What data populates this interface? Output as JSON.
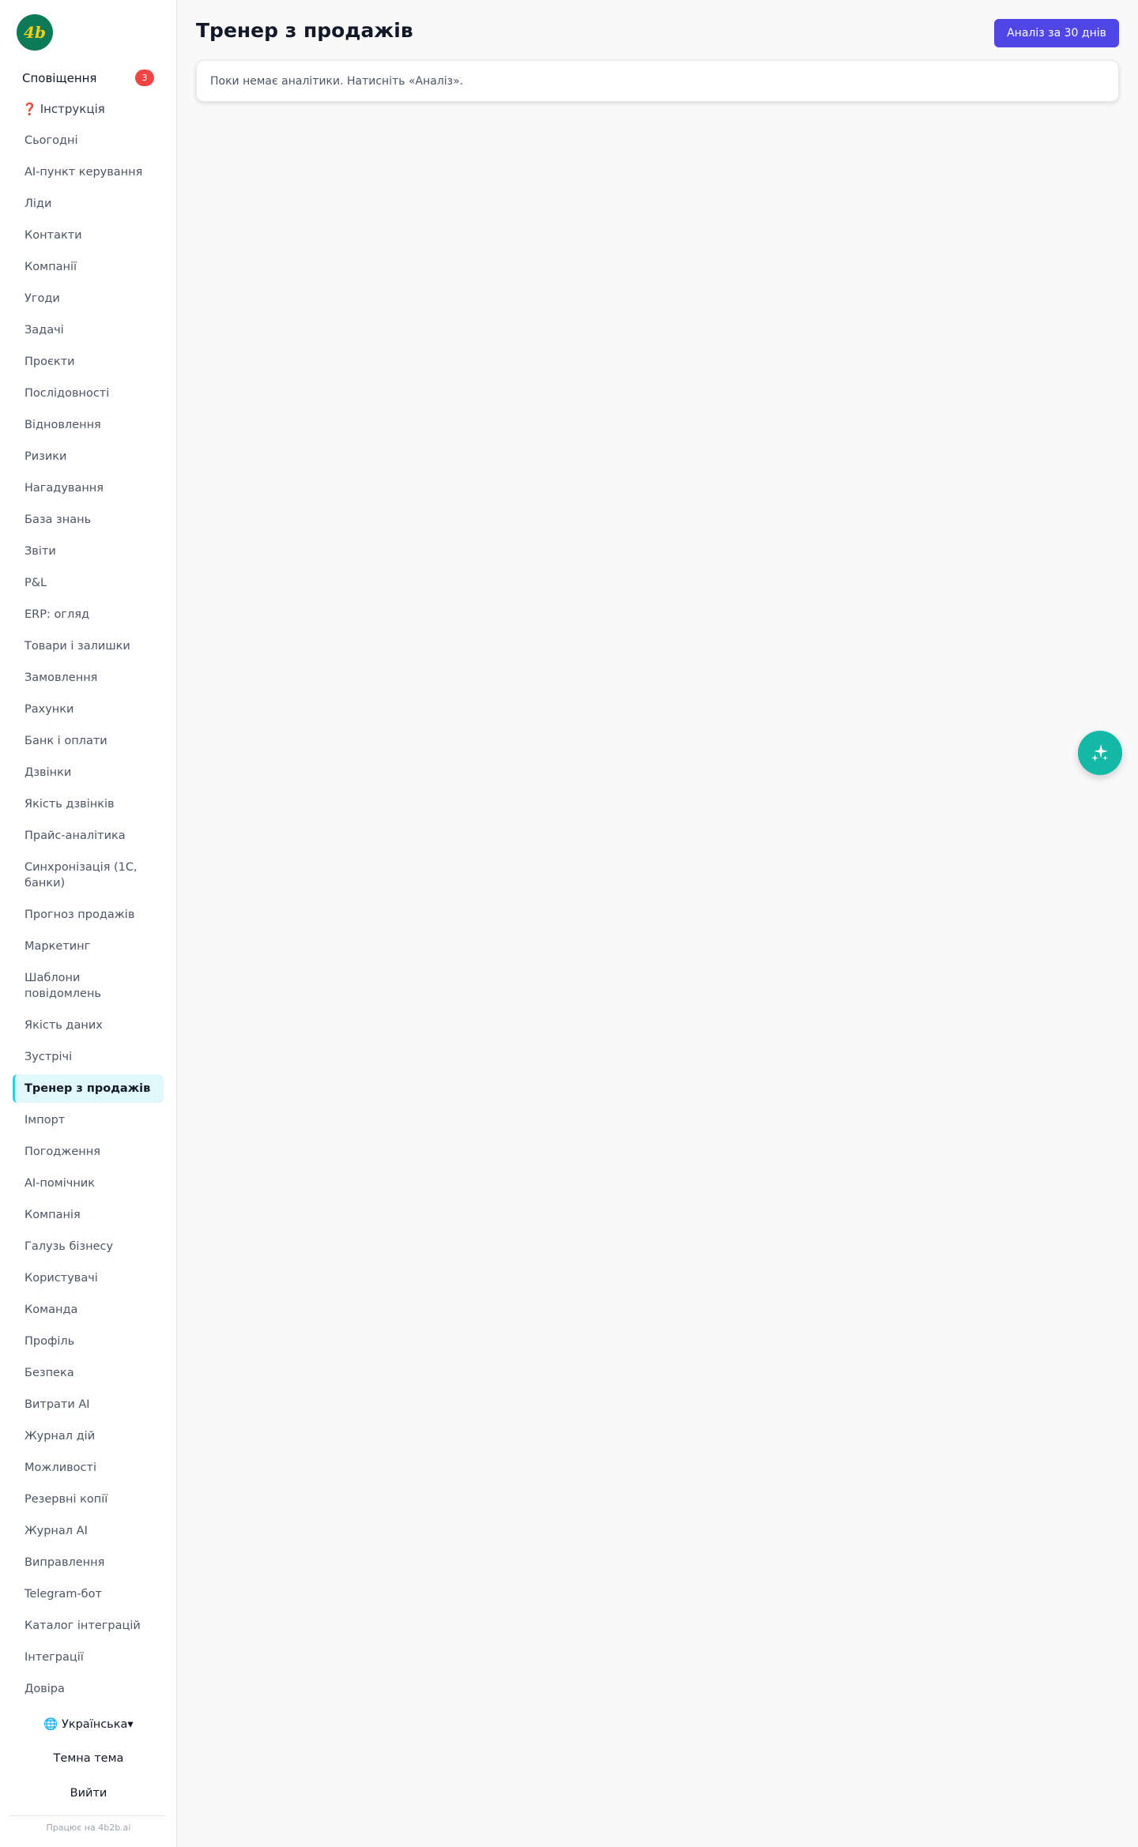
{
  "brand": {
    "logo_text": "4b",
    "logo_color": "#0d7a57",
    "logo_text_color": "#facc15"
  },
  "sidebar": {
    "notifications": {
      "label": "Сповіщення",
      "count": "3"
    },
    "help": {
      "icon": "question-icon",
      "label": "Інструкція"
    },
    "items": [
      {
        "label": "Сьогодні"
      },
      {
        "label": "AI-пункт керування"
      },
      {
        "label": "Ліди"
      },
      {
        "label": "Контакти"
      },
      {
        "label": "Компанії"
      },
      {
        "label": "Угоди"
      },
      {
        "label": "Задачі"
      },
      {
        "label": "Проєкти"
      },
      {
        "label": "Послідовності"
      },
      {
        "label": "Відновлення"
      },
      {
        "label": "Ризики"
      },
      {
        "label": "Нагадування"
      },
      {
        "label": "База знань"
      },
      {
        "label": "Звіти"
      },
      {
        "label": "P&L"
      },
      {
        "label": "ERP: огляд"
      },
      {
        "label": "Товари і залишки"
      },
      {
        "label": "Замовлення"
      },
      {
        "label": "Рахунки"
      },
      {
        "label": "Банк і оплати"
      },
      {
        "label": "Дзвінки"
      },
      {
        "label": "Якість дзвінків"
      },
      {
        "label": "Прайс-аналітика"
      },
      {
        "label": "Синхронізація (1С, банки)"
      },
      {
        "label": "Прогноз продажів"
      },
      {
        "label": "Маркетинг"
      },
      {
        "label": "Шаблони повідомлень"
      },
      {
        "label": "Якість даних"
      },
      {
        "label": "Зустрічі"
      },
      {
        "label": "Тренер з продажів",
        "active": true
      },
      {
        "label": "Імпорт"
      },
      {
        "label": "Погодження"
      },
      {
        "label": "AI-помічник"
      },
      {
        "label": "Компанія"
      },
      {
        "label": "Галузь бізнесу"
      },
      {
        "label": "Користувачі"
      },
      {
        "label": "Команда"
      },
      {
        "label": "Профіль"
      },
      {
        "label": "Безпека"
      },
      {
        "label": "Витрати AI"
      },
      {
        "label": "Журнал дій"
      },
      {
        "label": "Можливості"
      },
      {
        "label": "Резервні копії"
      },
      {
        "label": "Журнал AI"
      },
      {
        "label": "Виправлення"
      },
      {
        "label": "Telegram-бот"
      },
      {
        "label": "Каталог інтеграцій"
      },
      {
        "label": "Інтеграції"
      },
      {
        "label": "Довіра"
      }
    ],
    "language": {
      "icon": "globe-icon",
      "label": "🌐 Українська▾"
    },
    "theme_label": "Темна тема",
    "logout_label": "Вийти",
    "powered_by": "Працює на 4b2b.ai"
  },
  "main": {
    "title": "Тренер з продажів",
    "analyze_button": "Аналіз за 30 днів",
    "empty_state": "Поки немає аналітики. Натисніть «Аналіз»."
  },
  "fab": {
    "icon": "sparkles-icon",
    "color": "#14b8a6"
  },
  "colors": {
    "accent": "#4f46e5",
    "active_bg": "#e0f7fb",
    "active_border": "#22d3ee",
    "badge": "#ef4444"
  }
}
